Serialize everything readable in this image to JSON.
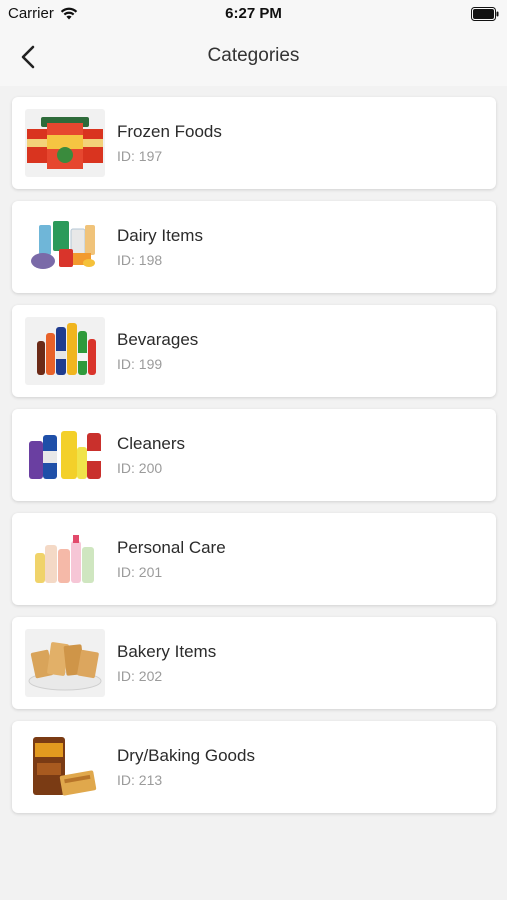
{
  "status_bar": {
    "carrier": "Carrier",
    "time": "6:27 PM"
  },
  "header": {
    "title": "Categories"
  },
  "categories": [
    {
      "name": "Frozen Foods",
      "id": "ID: 197"
    },
    {
      "name": "Dairy Items",
      "id": "ID: 198"
    },
    {
      "name": "Bevarages",
      "id": "ID: 199"
    },
    {
      "name": "Cleaners",
      "id": "ID: 200"
    },
    {
      "name": "Personal Care",
      "id": "ID: 201"
    },
    {
      "name": "Bakery Items",
      "id": "ID: 202"
    },
    {
      "name": "Dry/Baking Goods",
      "id": "ID: 213"
    }
  ]
}
